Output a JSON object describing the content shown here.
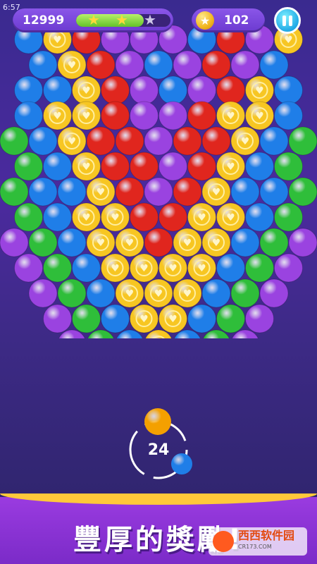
{
  "status_bar": {
    "time": "6:57"
  },
  "hud": {
    "score": "12999",
    "progress_fraction": 0.72,
    "stars_earned": 2,
    "stars_total": 3,
    "coins": "102"
  },
  "colors": {
    "blue": "#1f7ee8",
    "yellow": "#f7c622",
    "red": "#e0261e",
    "purple": "#9a43e0",
    "green": "#2fbe3a",
    "orange": "#f4a000"
  },
  "board": {
    "rows": [
      "BYRPPPBRPY",
      "BYRPBPRPB",
      "BBYRPBPRYB",
      "BYYRPPRYYB",
      "GBYRRPRRYBG",
      "GBYRRPRYBG",
      "GBBYRPRYBBG",
      "GBYYRRYYBG",
      "PGBYYRYYBGP",
      "PGBYYYYBGP",
      "PGBYYYBGP",
      "PGBYYBGP",
      "PGBYBGP"
    ]
  },
  "shooter": {
    "current_ball": "orange",
    "next_ball": "blue",
    "moves_left": "24"
  },
  "banner": {
    "text": "豐厚的獎勵!"
  },
  "watermark": {
    "text": "西西软件园",
    "sub": "CR173.COM"
  }
}
